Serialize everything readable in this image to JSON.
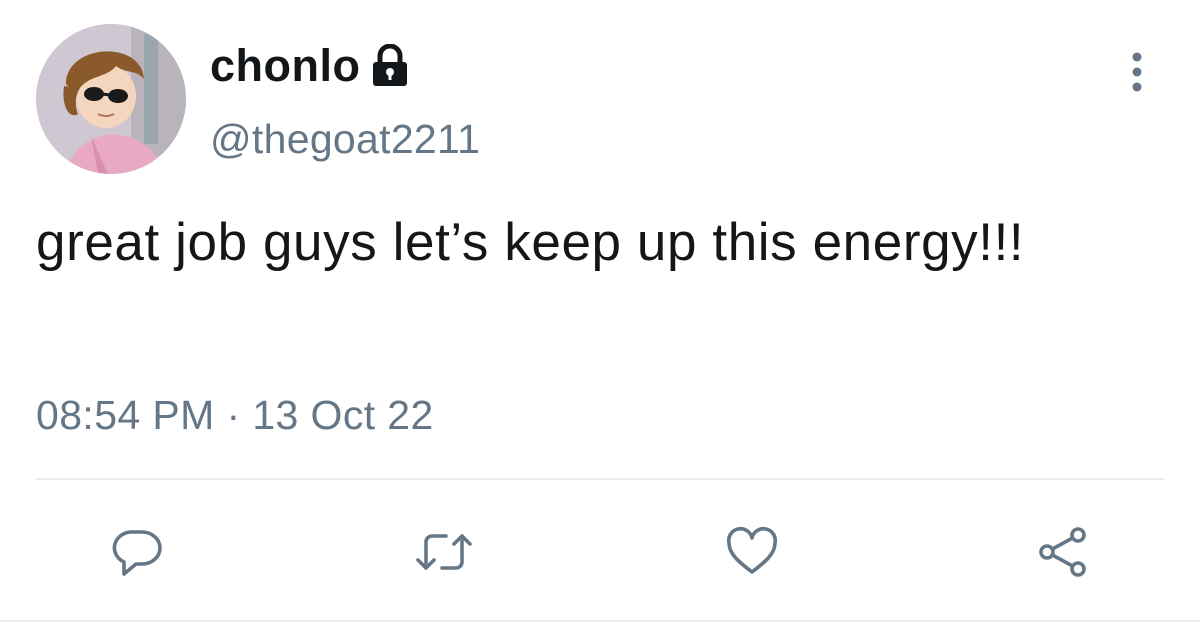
{
  "tweet": {
    "author": {
      "display_name": "chonlo",
      "handle": "@thegoat2211",
      "protected": true
    },
    "text": "great job guys let’s keep up this energy!!!",
    "timestamp": "08:54 PM · 13 Oct 22"
  },
  "icons": {
    "lock": "lock-icon",
    "more": "more-vertical-icon",
    "reply": "reply-icon",
    "retweet": "retweet-icon",
    "like": "heart-icon",
    "share": "share-icon"
  },
  "colors": {
    "text_primary": "#14171a",
    "text_secondary": "#657786",
    "icon": "#657786",
    "divider": "#e6ecf0"
  }
}
